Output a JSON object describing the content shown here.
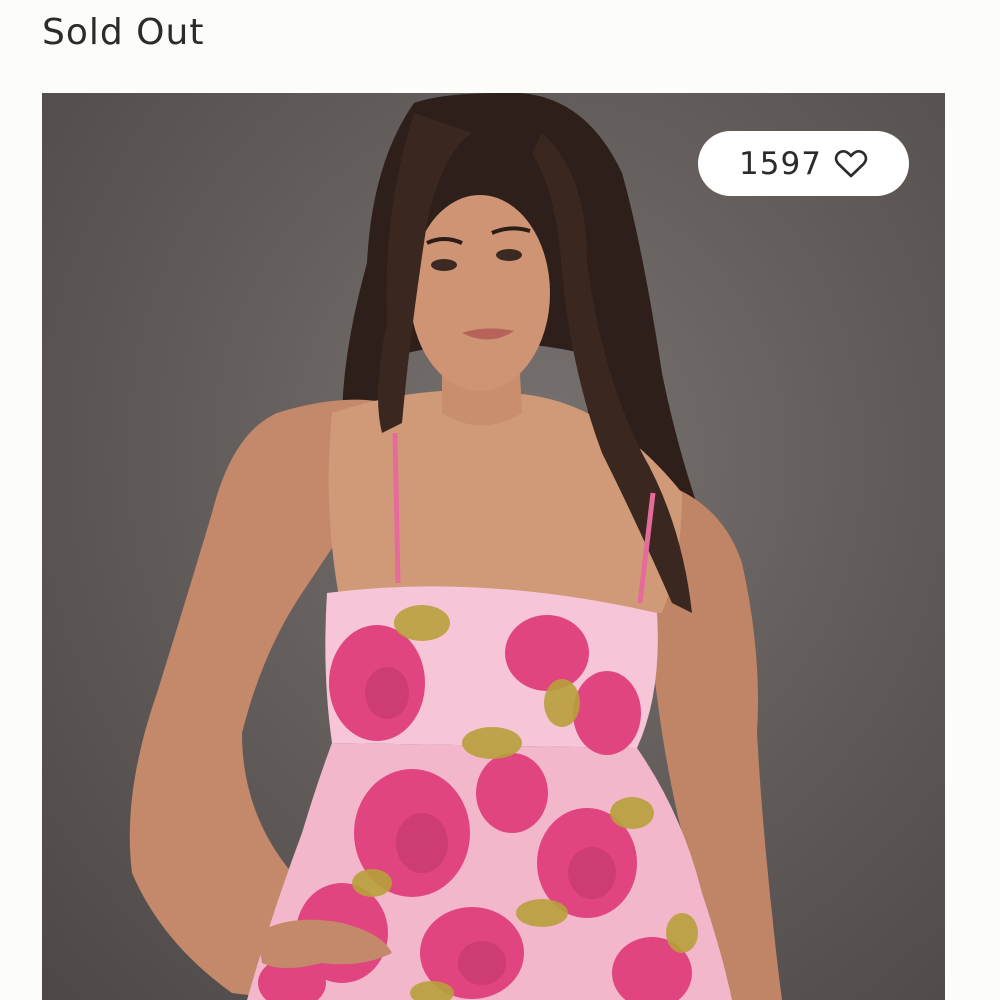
{
  "product": {
    "status_label": "Sold Out",
    "image_icon": "model-photo-pink-floral-jacquard-babydoll-dress"
  },
  "favorites": {
    "count": "1597",
    "icon": "heart-outline-icon"
  },
  "colors": {
    "background": "#fcfcf9",
    "text": "#2b2b2b",
    "pill": "#ffffff",
    "dress_pink": "#e0457f",
    "dress_light": "#f6c5d8",
    "dress_gold": "#b8a03c"
  }
}
